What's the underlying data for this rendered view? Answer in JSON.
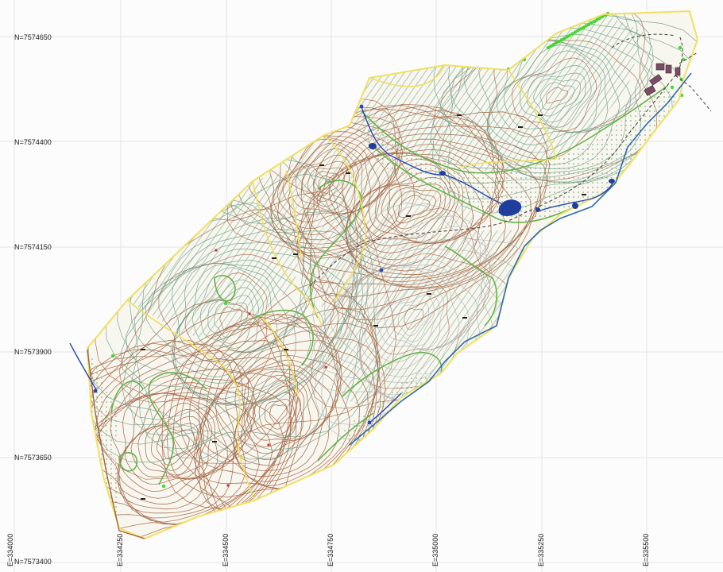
{
  "grid": {
    "northing_labels": [
      "N=7574650",
      "N=7574400",
      "N=7574150",
      "N=7573900",
      "N=7573650",
      "N=7573400"
    ],
    "easting_labels": [
      "E=334000",
      "E=334250",
      "E=334500",
      "E=334750",
      "E=335000",
      "E=335250",
      "E=335500"
    ]
  },
  "colors": {
    "grid_line": "#e4e4e4",
    "boundary": "#f0e060",
    "contour_brown": "#a3623f",
    "contour_green": "#6f9a83",
    "contour_gray": "#a8a8a8",
    "vegetation_edge": "#66b34a",
    "water": "#1f3e9e",
    "river_edge": "#2d6bb0",
    "hatch": "#7aa88a",
    "trail": "#4a4a4a",
    "building": "#7a4d66",
    "hedge": "#47d636"
  },
  "legend_features": [
    "property-boundary",
    "contour-lines",
    "vegetation-areas",
    "watercourses",
    "ponds",
    "trail",
    "buildings"
  ]
}
